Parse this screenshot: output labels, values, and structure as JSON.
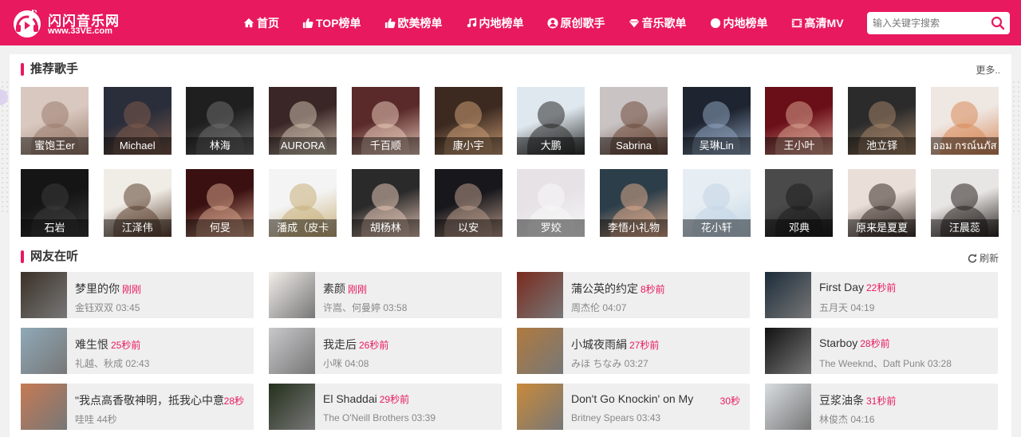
{
  "header": {
    "logo_name": "闪闪音乐网",
    "logo_url": "www.33VE.com",
    "nav": [
      {
        "label": "首页",
        "icon": "home-icon"
      },
      {
        "label": "TOP榜单",
        "icon": "thumbs-up-icon"
      },
      {
        "label": "欧美榜单",
        "icon": "thumbs-up-icon"
      },
      {
        "label": "内地榜单",
        "icon": "music-note-icon"
      },
      {
        "label": "原创歌手",
        "icon": "user-icon"
      },
      {
        "label": "音乐歌单",
        "icon": "diamond-icon"
      },
      {
        "label": "内地榜单",
        "icon": "circle-icon"
      },
      {
        "label": "高清MV",
        "icon": "film-icon"
      }
    ],
    "search_placeholder": "输入关键字搜索"
  },
  "recommended": {
    "title": "推荐歌手",
    "more": "更多..",
    "row1": [
      "蜜饱王er",
      "Michael",
      "林海",
      "AURORA",
      "千百顺",
      "康小宇",
      "大鹏",
      "Sabrina",
      "吴琳Lin",
      "王小叶",
      "池立铎",
      "ออม กรณ์นภัส"
    ],
    "row2": [
      "石岩",
      "江泽伟",
      "何旻",
      "潘成（皮卡",
      "胡杨林",
      "以安",
      "罗姣",
      "李悟小礼物",
      "花小轩",
      "邓典",
      "原来是夏夏",
      "汪晨蕊"
    ]
  },
  "listening": {
    "title": "网友在听",
    "refresh": "刷新",
    "songs": [
      {
        "title": "梦里的你",
        "ago": "刚刚",
        "meta": "金钰双双 03:45"
      },
      {
        "title": "素颜",
        "ago": "刚刚",
        "meta": "许嵩、何曼婷 03:58"
      },
      {
        "title": "蒲公英的约定",
        "ago": "8秒前",
        "meta": "周杰伦 04:07"
      },
      {
        "title": "First Day",
        "ago": "22秒前",
        "meta": "五月天 04:19"
      },
      {
        "title": "难生恨",
        "ago": "25秒前",
        "meta": "礼越、秋成 02:43"
      },
      {
        "title": "我走后",
        "ago": "26秒前",
        "meta": "小咪 04:08"
      },
      {
        "title": "小城夜雨絹",
        "ago": "27秒前",
        "meta": "みほ ちなみ 03:27"
      },
      {
        "title": "Starboy",
        "ago": "28秒前",
        "meta": "The Weeknd、Daft Punk 03:28"
      },
      {
        "title": "\"我点高香敬神明，抵我心中意",
        "ago_right": "28秒",
        "meta": "哇哇 44秒"
      },
      {
        "title": "El Shaddai",
        "ago": "29秒前",
        "meta": "The O'Neill Brothers 03:39"
      },
      {
        "title": "Don't Go Knockin' on My",
        "ago_right": "30秒",
        "meta": "Britney Spears 03:43"
      },
      {
        "title": "豆浆油条",
        "ago": "31秒前",
        "meta": "林俊杰 04:16"
      }
    ]
  },
  "colors": {
    "brand": "#e8195e"
  }
}
